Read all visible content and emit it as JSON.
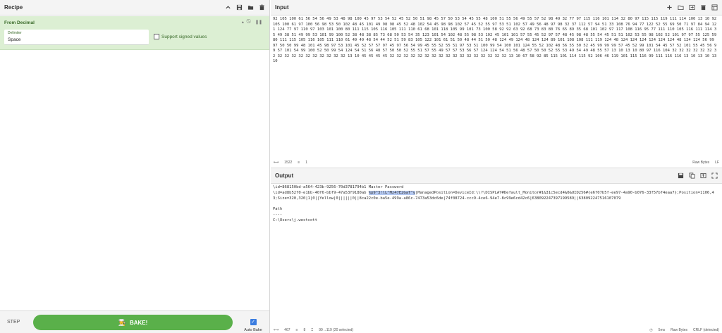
{
  "recipe": {
    "title": "Recipe",
    "icons": [
      "chevron-up-icon",
      "save-icon",
      "folder-icon",
      "trash-icon"
    ]
  },
  "operation": {
    "name": "From Decimal",
    "delimiter_label": "Delimiter",
    "delimiter_value": "Space",
    "signed_label": "Support signed values",
    "icons": [
      "chevron-up-icon",
      "disable-icon",
      "pause-icon"
    ]
  },
  "controls": {
    "step_label": "STEP",
    "bake_label": "BAKE!",
    "bake_icon": "chef-icon",
    "autobake_label": "Auto Bake"
  },
  "input": {
    "title": "Input",
    "icons": [
      "plus-icon",
      "folder-open-icon",
      "import-icon",
      "trash-icon",
      "layout-icon"
    ],
    "text": "92 105 100 61 56 54 56 49 53 48 98 100 45 97 53 54 52 45 52 50 51 98 45 57 50 53 54 45 55 48 100 51 55 56 49 55 57 52 98 49 32 77 97 115 116 101 114 32 80 97 115 115 119 111 114 100 13 10 92 105 100 61 97 100 56 98 53 50 102 48 45 101 49 98 98 45 52 48 102 54 45 98 98 102 57 45 52 55 97 53 51 102 57 49 56 48 97 98 32 37 112 57 94 51 33 108 76 94 77 122 52 55 69 50 71 97 84 94 121 124 77 97 110 97 103 101 100 80 111 115 105 116 105 111 110 61 68 101 118 105 99 101 73 100 58 92 92 63 92 68 73 83 80 76 65 89 35 68 101 102 97 117 108 116 95 77 111 110 105 116 111 114 35 49 38 51 49 99 53 101 99 100 52 38 48 38 85 73 68 50 53 54 35 123 101 54 102 48 55 98 53 102 45 101 101 57 55 45 52 97 57 48 45 98 48 55 54 45 51 51 102 53 55 98 102 52 101 97 97 55 125 59 80 111 115 105 116 105 111 110 61 49 49 48 54 44 52 51 59 83 105 122 101 61 51 50 48 44 51 50 48 124 49 124 48 124 124 89 101 108 108 111 119 124 48 124 124 124 124 124 124 48 124 124 56 99 97 50 50 99 48 101 45 98 97 53 101 45 52 57 57 97 45 97 56 54 99 45 55 52 55 51 97 53 51 100 99 54 100 101 124 55 52 102 48 56 55 50 52 45 99 99 99 57 45 52 99 101 54 45 57 52 101 55 45 56 99 57 101 54 99 100 52 50 99 54 124 54 51 56 48 57 50 50 52 55 51 57 55 49 57 57 53 56 57 124 124 54 51 56 48 57 50 50 52 55 53 49 54 49 48 55 57 13 10 13 10 80 97 116 104 32 32 32 32 32 32 32 32 32 32 32 32 32 32 32 32 32 13 10 45 45 45 45 32 32 32 32 32 32 32 32 32 32 32 32 32 32 32 32 32 13 10 67 58 92 85 115 101 114 115 92 106 46 119 101 115 116 99 111 116 116 13 10 13 10 13 10",
    "status_length": "1522",
    "status_lines": "1",
    "status_encoding": "Raw Bytes",
    "status_eol": "LF"
  },
  "output": {
    "title": "Output",
    "icons": [
      "save-icon",
      "copy-icon",
      "replace-input-icon",
      "maximize-icon"
    ],
    "line1": "\\id=868150bd-a564-423b-9256-70d3781794b1 Master Password",
    "line2_pre": "\\id=ad8b52f0-e1bb-40f6-bbf9-47a53f9180ab ",
    "line2_sel": "%p9^3!lL^Mz47E2GaT^y",
    "line2_post": "|ManagedPosition=DeviceId:\\\\?\\DISPLAY#Default_Monitor#1&31c5ecd4&0&UID256#{e6f07b5f-ee97-4a90-b076-33f57bf4eaa7};Position=1106,43;Size=320,320|1|0||Yellow|0||||||0||8ca22c0e-ba5e-499a-a86c-7473a53dc6de|74f08724-ccc9-4ce6-94e7-8c99e6cd42c6|638092247397199589||638092247516107079",
    "line3": "Path",
    "line4": "----",
    "line5": "C:\\Users\\j.westcott",
    "status_length": "467",
    "status_lines": "8",
    "status_selection": "99→119 (20 selected)",
    "status_time": "5ms",
    "status_encoding": "Raw Bytes",
    "status_eol": "CRLF (detected)"
  }
}
